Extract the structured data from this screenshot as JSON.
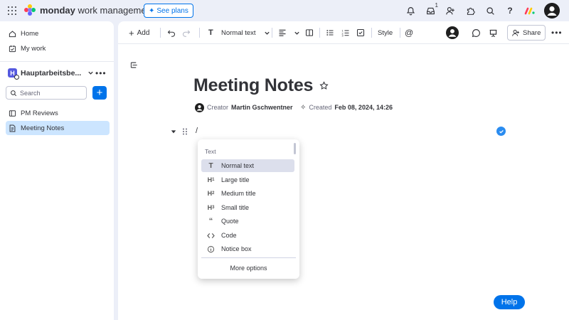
{
  "brand": {
    "name_bold": "monday",
    "name_rest": "work management",
    "see_plans": "See plans"
  },
  "topbar": {
    "inbox_badge": "1"
  },
  "sidebar": {
    "home": "Home",
    "my_work": "My work",
    "workspace": "Hauptarbeitsbe...",
    "workspace_initial": "H",
    "search_placeholder": "Search",
    "items": [
      {
        "label": "PM Reviews"
      },
      {
        "label": "Meeting Notes"
      }
    ]
  },
  "toolbar": {
    "add": "Add",
    "text_style": "Normal text",
    "style": "Style",
    "share": "Share"
  },
  "doc": {
    "title": "Meeting Notes",
    "creator_label": "Creator",
    "creator_name": "Martin Gschwentner",
    "created_label": "Created",
    "created_value": "Feb 08, 2024, 14:26",
    "slash": "/"
  },
  "menu": {
    "section": "Text",
    "items": [
      {
        "icon": "T",
        "label": "Normal text"
      },
      {
        "icon": "H1",
        "label": "Large title"
      },
      {
        "icon": "H2",
        "label": "Medium title"
      },
      {
        "icon": "H3",
        "label": "Small title"
      },
      {
        "icon": "quote",
        "label": "Quote"
      },
      {
        "icon": "code",
        "label": "Code"
      },
      {
        "icon": "info",
        "label": "Notice box"
      }
    ],
    "more": "More options"
  },
  "help": "Help",
  "colors": {
    "accent": "#0073ea",
    "active_bg": "#cce5ff",
    "workspace": "#5559df"
  }
}
